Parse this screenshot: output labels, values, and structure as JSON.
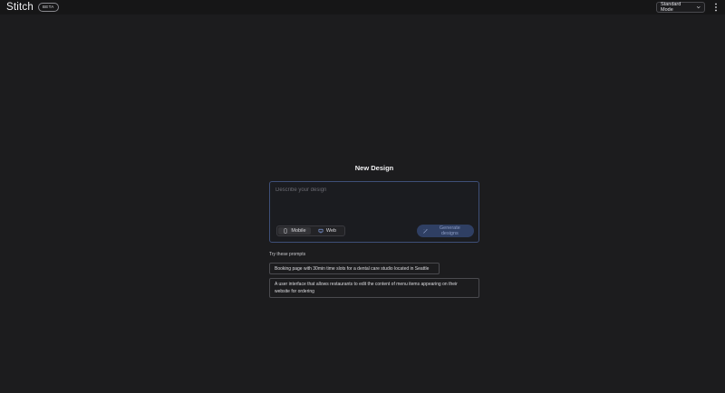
{
  "header": {
    "brand": "Stitch",
    "badge": "BETA",
    "mode_select": {
      "value": "Standard Mode"
    },
    "more_icon": "kebab-vertical-icon"
  },
  "main": {
    "title": "New Design",
    "prompt": {
      "placeholder": "Describe your design",
      "value": ""
    },
    "device_toggle": {
      "selected": "Mobile",
      "options": [
        {
          "label": "Mobile",
          "icon": "phone-icon"
        },
        {
          "label": "Web",
          "icon": "monitor-icon"
        }
      ]
    },
    "generate_button": {
      "label": "Generate designs",
      "icon": "magic-wand-icon"
    },
    "suggestions": {
      "heading": "Try these prompts",
      "items": [
        "Booking page with 30min time slots for a dental care studio located in Seattle",
        "A user interface that allows restaurants to edit the content of menu items appearing on their website for ordering"
      ]
    }
  },
  "colors": {
    "background": "#1c1c1e",
    "topbar": "#161617",
    "prompt_border": "#3e4f78",
    "generate_bg": "#2f3f63",
    "generate_text": "#8c9cc4"
  }
}
